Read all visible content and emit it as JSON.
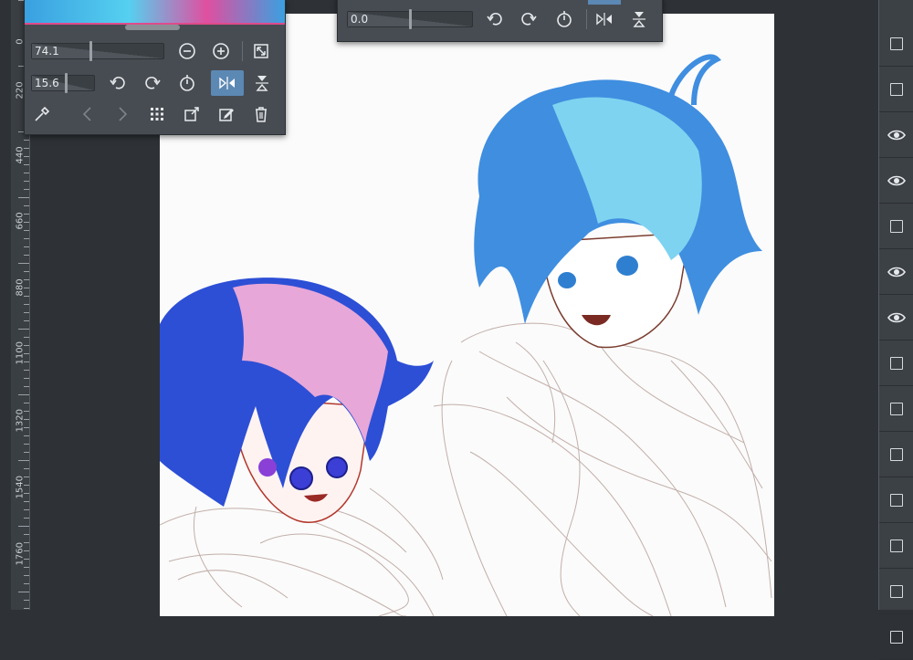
{
  "navigator": {
    "zoom_value": "74.1",
    "zoom_fraction": 0.45,
    "rotation_value": "15.6",
    "rotation_fraction": 0.55,
    "icons": [
      "zoom-out-icon",
      "zoom-in-icon",
      "fit-icon",
      "rotate-left-icon",
      "rotate-right-icon",
      "reset-rotation-icon",
      "flip-horizontal-icon",
      "flip-vertical-icon",
      "eyedropper-icon",
      "back-icon",
      "forward-icon",
      "grid-icon",
      "new-window-icon",
      "edit-icon",
      "trash-icon"
    ]
  },
  "navigator2": {
    "rotation_value": "0.0",
    "rotation_fraction": 0.5
  },
  "ruler": {
    "labels": [
      "0",
      "220",
      "440",
      "660",
      "880",
      "1100",
      "1320",
      "1540",
      "1760"
    ]
  },
  "layers": {
    "rows": [
      false,
      false,
      true,
      true,
      false,
      true,
      true,
      false,
      false,
      false,
      false,
      false,
      false,
      false
    ]
  },
  "colors": {
    "panel": "#474c52",
    "active": "#5c88b4",
    "canvas": "#fbfbfb",
    "workspace": "#2e3236"
  }
}
